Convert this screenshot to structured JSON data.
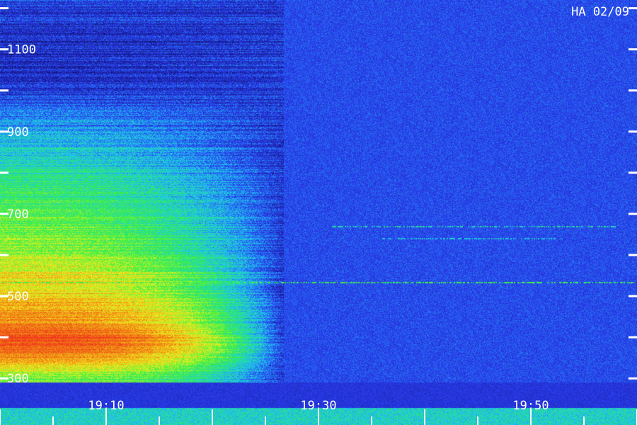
{
  "chart_data": {
    "type": "heatmap",
    "title": "HA 02/09",
    "xlabel": "",
    "ylabel": "",
    "x_tick_labels": [
      "19:10",
      "19:30",
      "19:50"
    ],
    "y_tick_labels": [
      "1100",
      "900",
      "700",
      "500",
      "300"
    ],
    "time_range": [
      "19:00",
      "20:00"
    ],
    "x_labeled_ticks_minutes": [
      10,
      30,
      50
    ],
    "x_minor_tick_step_minutes": 5,
    "y_range": [
      290,
      1220
    ],
    "y_labeled_ticks": [
      1100,
      900,
      700,
      500,
      300
    ],
    "y_tick_step": 100,
    "colormap": [
      "#10106a",
      "#2a3cf0",
      "#1ec8f0",
      "#32f046",
      "#f0f01e",
      "#f08214",
      "#f0321e"
    ],
    "background_color": "#0e0e55",
    "burst_region": {
      "start": "19:00",
      "end": "19:26.7",
      "freq_low": 300,
      "freq_high": 1220
    },
    "intensity_profile": [
      {
        "freq": 300,
        "level": 0.55
      },
      {
        "freq": 330,
        "level": 0.7
      },
      {
        "freq": 360,
        "level": 0.85
      },
      {
        "freq": 400,
        "level": 0.95
      },
      {
        "freq": 440,
        "level": 0.82
      },
      {
        "freq": 500,
        "level": 0.74
      },
      {
        "freq": 560,
        "level": 0.68
      },
      {
        "freq": 620,
        "level": 0.58
      },
      {
        "freq": 700,
        "level": 0.52
      },
      {
        "freq": 780,
        "level": 0.45
      },
      {
        "freq": 860,
        "level": 0.36
      },
      {
        "freq": 940,
        "level": 0.25
      },
      {
        "freq": 1000,
        "level": 0.14
      },
      {
        "freq": 1060,
        "level": 0.1
      },
      {
        "freq": 1140,
        "level": 0.12
      },
      {
        "freq": 1220,
        "level": 0.16
      }
    ],
    "interference_lines": [
      {
        "freq": 535,
        "start": "19:00",
        "end": "20:00",
        "level": 0.45
      },
      {
        "freq": 670,
        "start": "19:31",
        "end": "19:58",
        "level": 0.35
      },
      {
        "freq": 642,
        "start": "19:36",
        "end": "19:53",
        "level": 0.3
      }
    ]
  }
}
